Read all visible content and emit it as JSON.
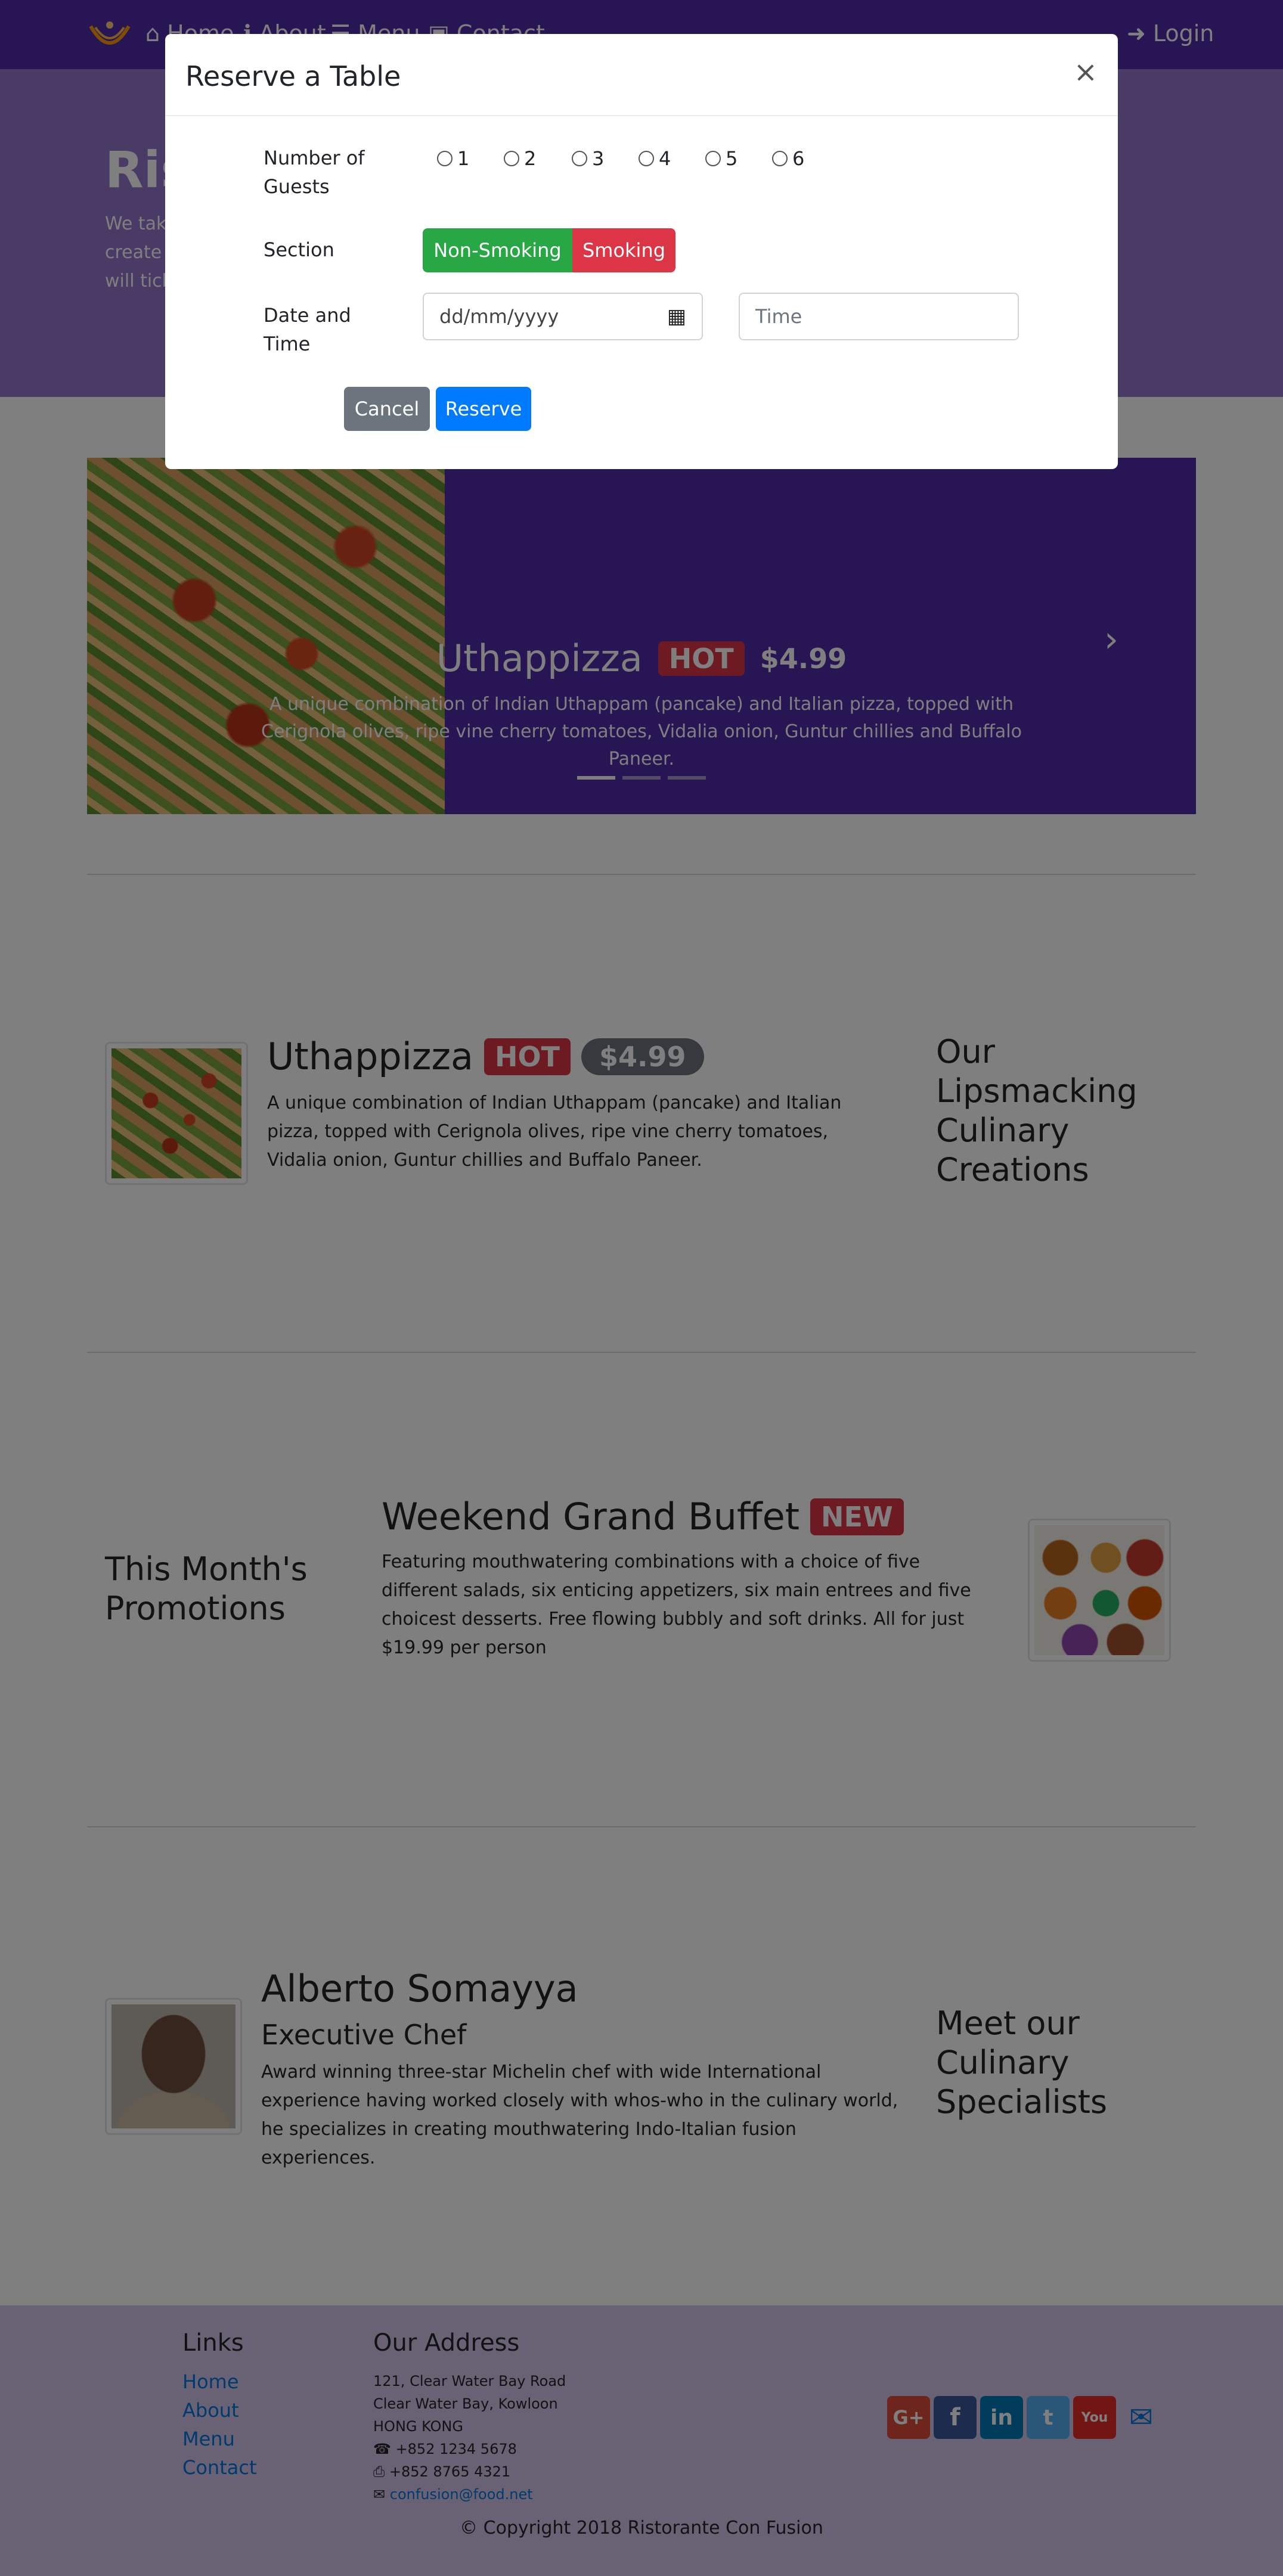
{
  "nav": {
    "items": [
      {
        "label": "Home",
        "icon": "home-icon"
      },
      {
        "label": "About",
        "icon": "info-icon"
      },
      {
        "label": "Menu",
        "icon": "list-icon"
      },
      {
        "label": "Contact",
        "icon": "address-card-icon"
      }
    ],
    "login": "Login"
  },
  "jumbotron": {
    "title": "Ris",
    "lines": [
      "We tak",
      "create a",
      "will tick"
    ]
  },
  "carousel": {
    "title": "Uthappizza",
    "badge": "HOT",
    "price": "$4.99",
    "description": "A unique combination of Indian Uthappam (pancake) and Italian pizza, topped with Cerignola olives, ripe vine cherry tomatoes, Vidalia onion, Guntur chillies and Buffalo Paneer."
  },
  "dish": {
    "title": "Uthappizza",
    "badge": "HOT",
    "price": "$4.99",
    "description": "A unique combination of Indian Uthappam (pancake) and Italian pizza, topped with Cerignola olives, ripe vine cherry tomatoes, Vidalia onion, Guntur chillies and Buffalo Paneer.",
    "section_title": "Our Lipsmacking Culinary Creations"
  },
  "promotion": {
    "section_title": "This Month's Promotions",
    "title": "Weekend Grand Buffet",
    "badge": "NEW",
    "description": "Featuring mouthwatering combinations with a choice of five different salads, six enticing appetizers, six main entrees and five choicest desserts. Free flowing bubbly and soft drinks. All for just $19.99 per person"
  },
  "leader": {
    "name": "Alberto Somayya",
    "role": "Executive Chef",
    "description": "Award winning three-star Michelin chef with wide International experience having worked closely with whos-who in the culinary world, he specializes in creating mouthwatering Indo-Italian fusion experiences.",
    "section_title": "Meet our Culinary Specialists"
  },
  "footer": {
    "links_title": "Links",
    "links": [
      "Home",
      "About",
      "Menu",
      "Contact"
    ],
    "address_title": "Our Address",
    "address": [
      "121, Clear Water Bay Road",
      "Clear Water Bay, Kowloon",
      "HONG KONG"
    ],
    "phone": "+852 1234 5678",
    "fax": "+852 8765 4321",
    "email": "confusion@food.net",
    "copyright": "© Copyright 2018 Ristorante Con Fusion",
    "social": [
      "google-plus-icon",
      "facebook-icon",
      "linkedin-icon",
      "twitter-icon",
      "youtube-icon",
      "envelope-icon"
    ]
  },
  "modal": {
    "title": "Reserve a Table",
    "close": "×",
    "guests_label": "Number of Guests",
    "guests_options": [
      "1",
      "2",
      "3",
      "4",
      "5",
      "6"
    ],
    "section_label": "Section",
    "section_options": [
      "Non-Smoking",
      "Smoking"
    ],
    "datetime_label": "Date and Time",
    "date_placeholder": "dd/mm/yyyy",
    "time_placeholder": "Time",
    "cancel": "Cancel",
    "reserve": "Reserve"
  },
  "colors": {
    "primary": "#512da8",
    "jumbotron": "#9575cd",
    "footer": "#d1c4e9",
    "success": "#28a745",
    "danger": "#dc3545",
    "secondary": "#6c757d",
    "blue": "#007bff"
  }
}
